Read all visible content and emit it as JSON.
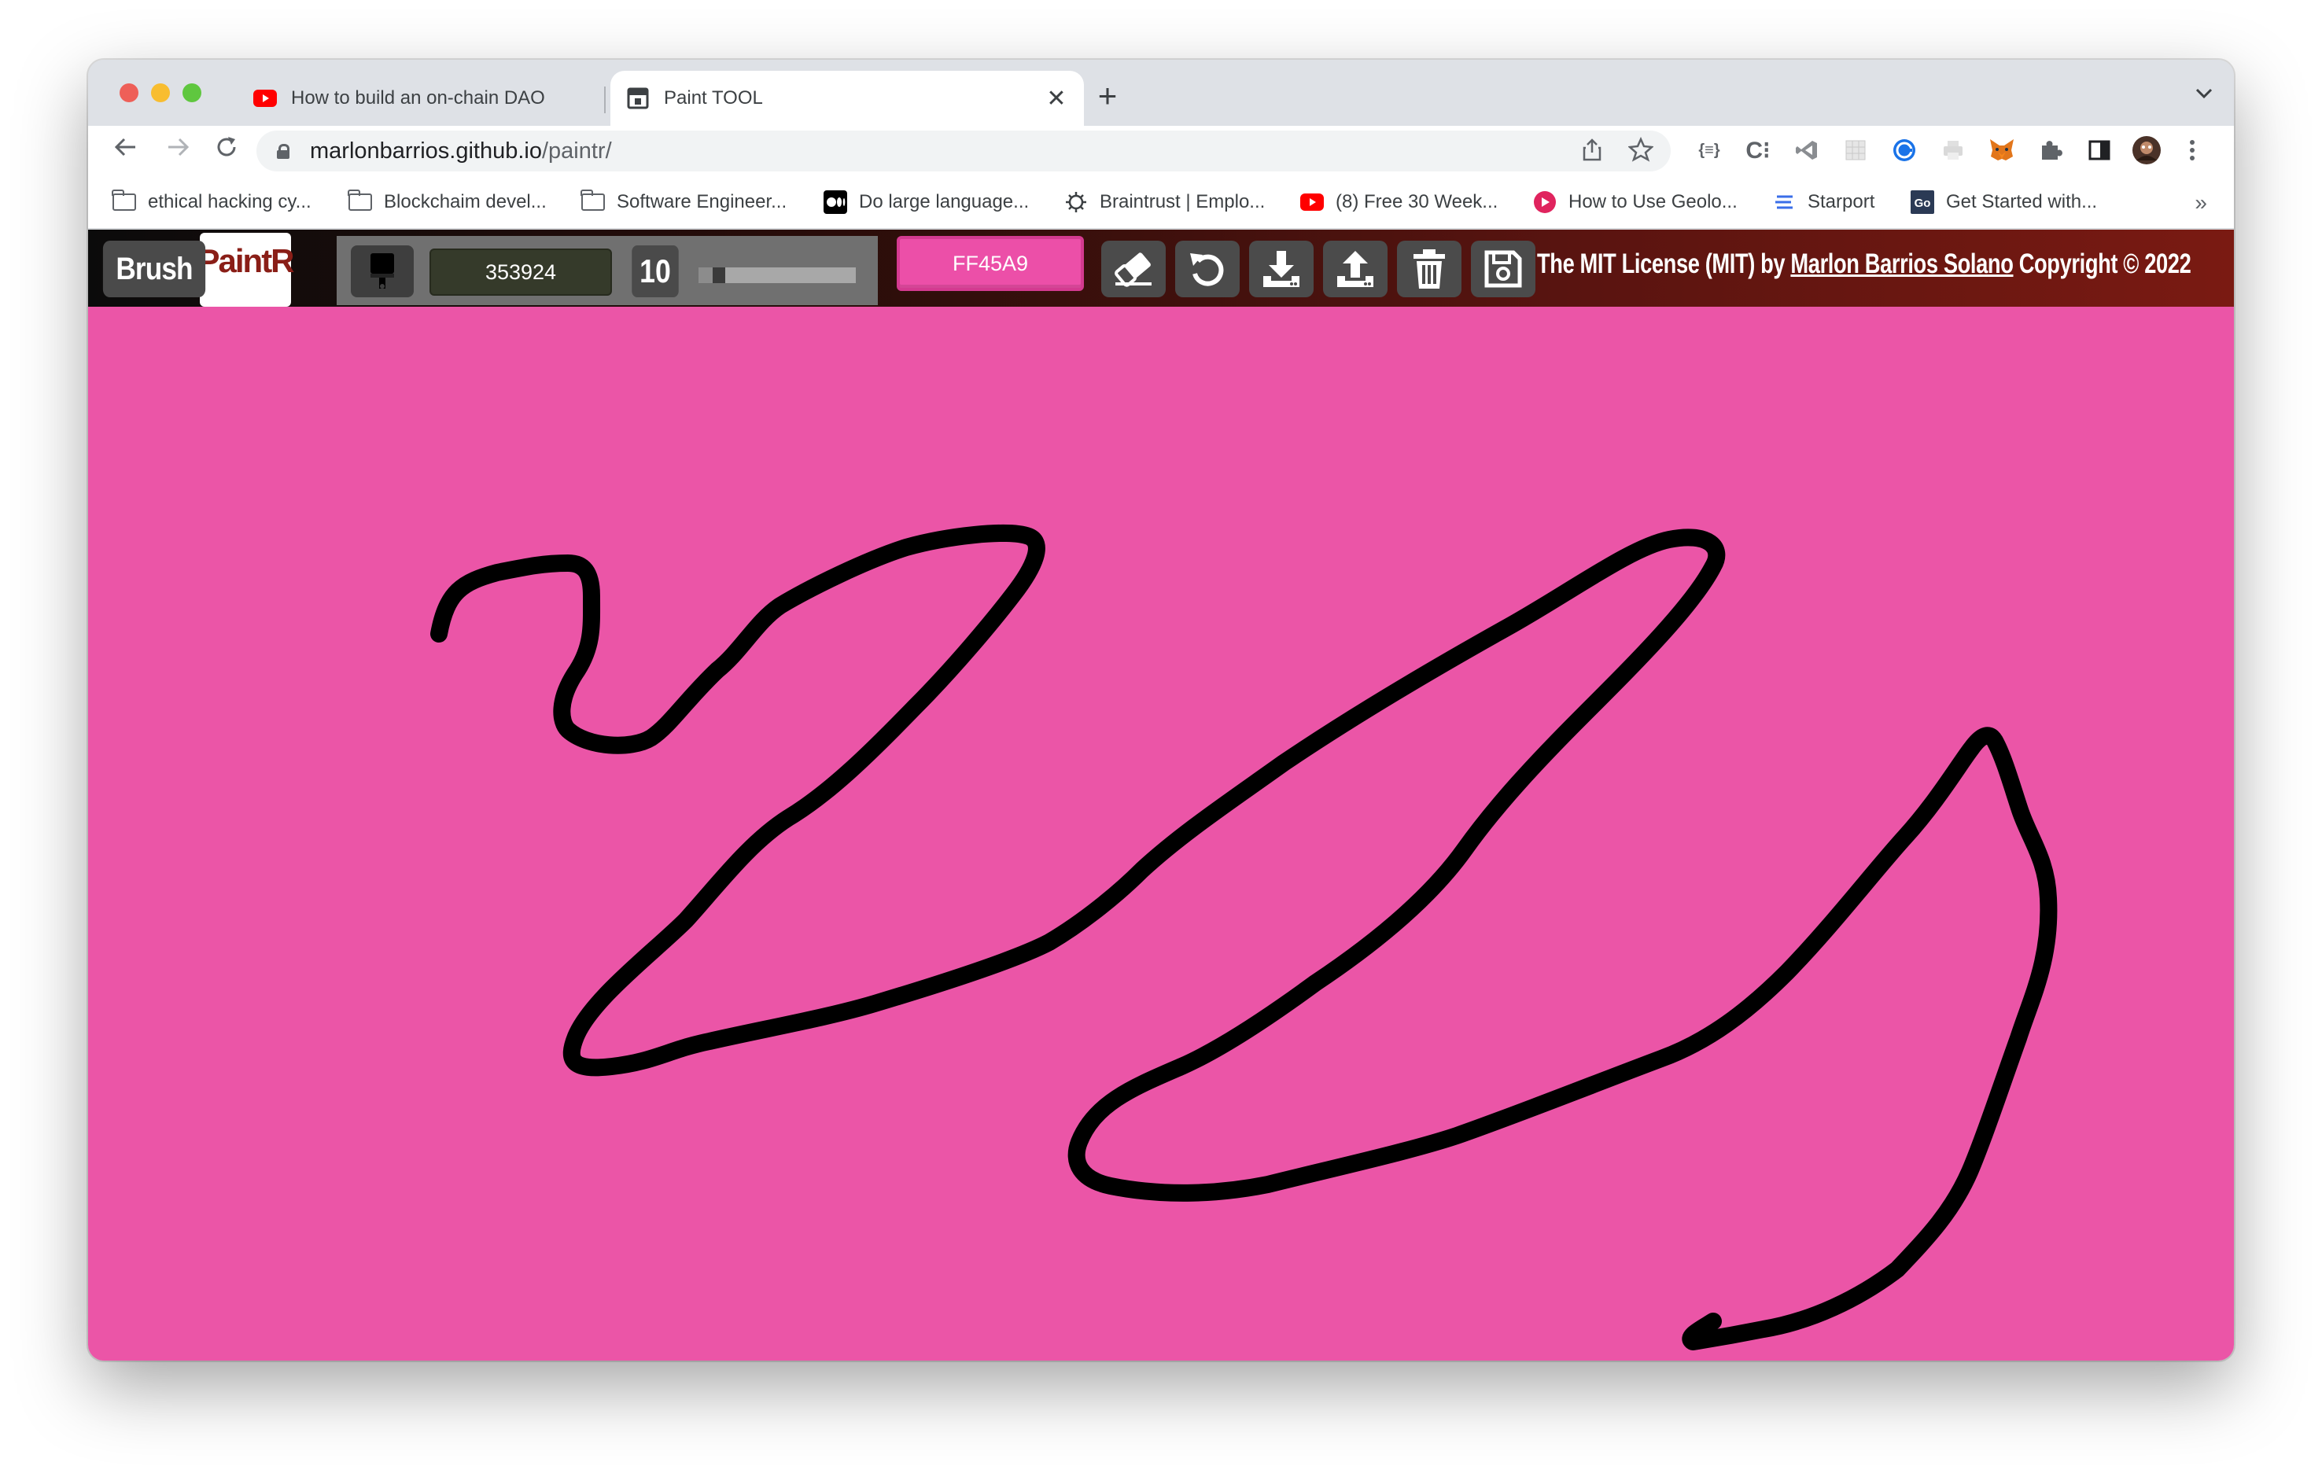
{
  "browser": {
    "tabs": [
      {
        "title": "How to build an on-chain DAO",
        "close": "✕",
        "favicon": "youtube-icon"
      },
      {
        "title": "Paint TOOL",
        "close": "✕",
        "favicon": "paint-tool-favicon"
      }
    ],
    "new_tab": "+",
    "tab_menu": "⌄",
    "url_host": "marlonbarrios.github.io",
    "url_path": "/paintr/",
    "bookmarks": [
      {
        "label": "ethical hacking cy...",
        "icon": "folder-icon"
      },
      {
        "label": "Blockchaim devel...",
        "icon": "folder-icon"
      },
      {
        "label": "Software Engineer...",
        "icon": "folder-icon"
      },
      {
        "label": "Do large language...",
        "icon": "medium-icon"
      },
      {
        "label": "Braintrust | Emplo...",
        "icon": "braintrust-icon"
      },
      {
        "label": "(8) Free 30 Week...",
        "icon": "youtube-icon"
      },
      {
        "label": "How to Use Geolo...",
        "icon": "site-icon"
      },
      {
        "label": "Starport",
        "icon": "starport-icon"
      },
      {
        "label": "Get Started with...",
        "icon": "go-icon"
      }
    ],
    "bookmarks_more": "»"
  },
  "app": {
    "brush_label": "Brush",
    "logo": "PaintR",
    "brush_color": "353924",
    "brush_size": "10",
    "brush_size_fraction": 0.1,
    "background_color_label": "FF45A9",
    "license_prefix": "The MIT License (MIT) by ",
    "license_author": "Marlon Barrios Solano",
    "license_suffix": " Copyright © 2022",
    "tools": [
      "eraser-icon",
      "undo-icon",
      "download-icon",
      "upload-icon",
      "trash-icon",
      "save-icon"
    ]
  },
  "colors": {
    "canvas_background": "#eb55a7",
    "stroke": "#000000",
    "background_button": "#ec4fa8",
    "brand": "#8a1e17"
  }
}
